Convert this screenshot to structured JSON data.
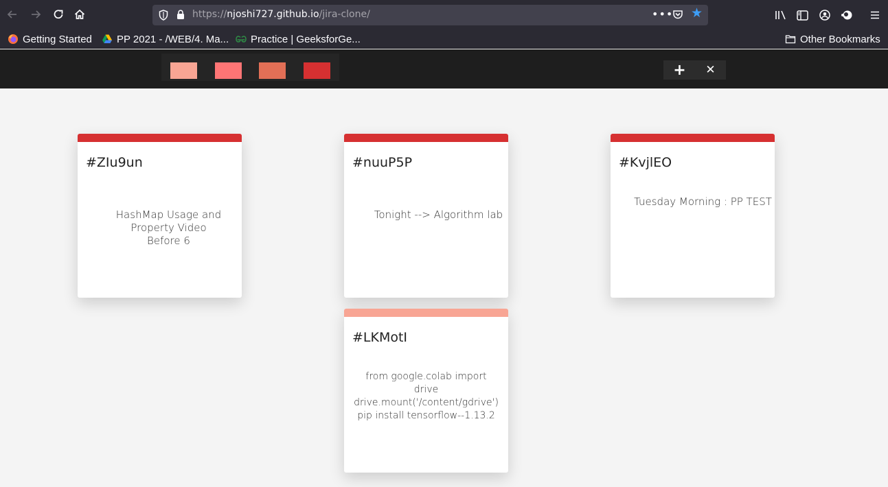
{
  "browser": {
    "url_prefix": "https://",
    "url_host": "njoshi727.github.io",
    "url_path": "/jira-clone/",
    "icons": {
      "back": "arrow-left-icon",
      "forward": "arrow-right-icon",
      "reload": "reload-icon",
      "home": "home-icon",
      "page_actions": "meatball-menu-icon",
      "pocket": "pocket-icon",
      "bookmark": "star-icon",
      "library": "library-icon",
      "sidebar": "sidebar-icon",
      "account": "account-icon",
      "extension": "extension-icon",
      "menu": "hamburger-menu-icon"
    },
    "bookmarks": [
      {
        "label": "Getting Started",
        "icon": "firefox-icon"
      },
      {
        "label": "PP 2021 - /WEB/4. Ma...",
        "icon": "google-drive-icon"
      },
      {
        "label": "Practice | GeeksforGe...",
        "icon": "geeksforgeeks-icon"
      }
    ],
    "other_bookmarks": {
      "label": "Other Bookmarks",
      "icon": "folder-icon"
    }
  },
  "toolbar": {
    "filter_colors": [
      "#f8a594",
      "#ff7575",
      "#e26f56",
      "#d63031"
    ],
    "add_label": "+",
    "remove_label": "✕"
  },
  "tickets": [
    {
      "id": "#ZIu9un",
      "color": "#d63031",
      "lines": [
        "HashMap Usage and",
        "Property Video",
        "Before 6"
      ]
    },
    {
      "id": "#nuuP5P",
      "color": "#d63031",
      "lines": [
        "Tonight --> Algorithm lab"
      ]
    },
    {
      "id": "#KvjlEO",
      "color": "#d63031",
      "lines": [
        "Tuesday Morning : PP TEST"
      ]
    },
    {
      "id": "#LKMotI",
      "color": "#f8a594",
      "lines": [
        "from google.colab import",
        "drive",
        "drive.mount('/content/gdrive')",
        "pip install tensorflow--1.13.2"
      ]
    }
  ]
}
